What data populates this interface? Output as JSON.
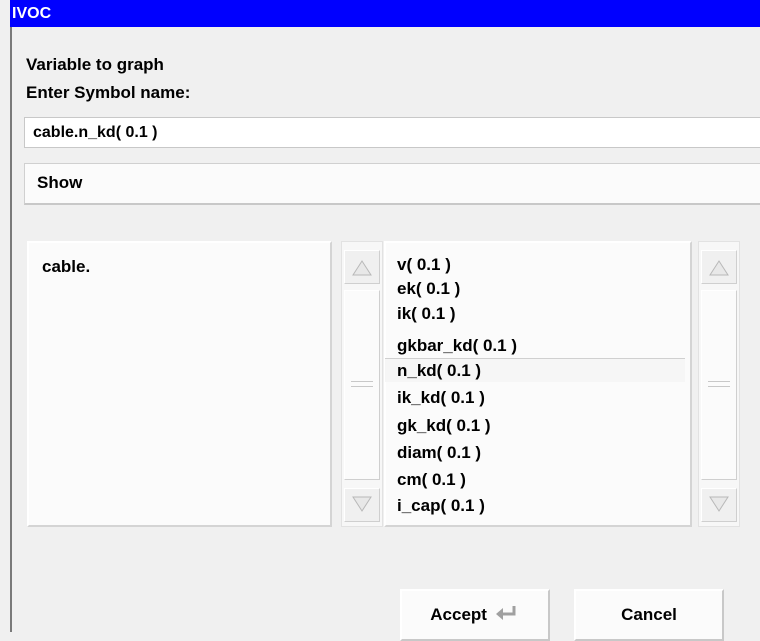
{
  "window": {
    "title": "IVOC"
  },
  "prompt": {
    "line1": "Variable to graph",
    "line2": "Enter  Symbol name:"
  },
  "symbol_input": {
    "value": "cable.n_kd( 0.1 )"
  },
  "show_button": {
    "label": "Show"
  },
  "left_list": {
    "items": [
      "cable."
    ]
  },
  "right_list": {
    "items": [
      "v( 0.1 )",
      "ek( 0.1 )",
      "ik( 0.1 )",
      "gkbar_kd( 0.1 )",
      "n_kd( 0.1 )",
      "ik_kd( 0.1 )",
      "gk_kd( 0.1 )",
      "diam( 0.1 )",
      "cm( 0.1 )",
      "i_cap( 0.1 )"
    ],
    "selected": "n_kd( 0.1 )"
  },
  "buttons": {
    "accept": "Accept",
    "cancel": "Cancel"
  },
  "icons": {
    "accept": "enter-arrow-icon",
    "scroll_up": "triangle-up-icon",
    "scroll_down": "triangle-down-icon"
  }
}
